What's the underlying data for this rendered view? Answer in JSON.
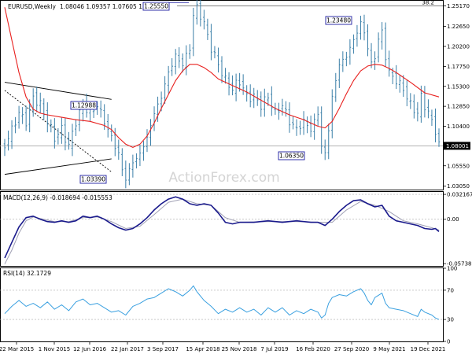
{
  "header": {
    "symbol": "EURUSD,Weekly",
    "ohlc": "1.08046 1.09357 1.07605 1.08001"
  },
  "watermark": "ActionForex.com",
  "colors": {
    "candle": "#3a7fa8",
    "moving_average": "#e8201e",
    "macd_line": "#1a1a8c",
    "macd_signal": "#a0a0b4",
    "rsi_line": "#3aa0e0",
    "trendline": "#000000",
    "box_border": "#1a1aa0",
    "price_box_bg": "#000000"
  },
  "chart_data": [
    {
      "type": "candlestick",
      "panel": "price",
      "series_names": [],
      "ylim": [
        1.0263,
        1.258
      ],
      "y_ticks": [
        "1.25170",
        "1.22650",
        "1.20200",
        "1.17750",
        "1.15300",
        "1.12850",
        "1.10400",
        "1.07950",
        "1.05550",
        "1.03050"
      ],
      "level_line": {
        "label": "38.2",
        "value": 1.2517
      },
      "current_price": {
        "label": "1.08001",
        "value": 1.08001
      },
      "annotations": [
        {
          "label": "1.25550",
          "value": 1.2555
        },
        {
          "label": "1.23480",
          "value": 1.2348
        },
        {
          "label": "1.12988",
          "value": 1.1299
        },
        {
          "label": "1.06350",
          "value": 1.0635
        },
        {
          "label": "1.03390",
          "value": 1.0339
        }
      ],
      "trend_channel": {
        "upper": {
          "from": 1.158,
          "to": 1.137
        },
        "lower": {
          "from": 1.045,
          "to": 1.064
        }
      },
      "x_ticks": [
        "22 Mar 2015",
        "1 Nov 2015",
        "12 Jun 2016",
        "22 Jan 2017",
        "3 Sep 2017",
        "15 Apr 2018",
        "25 Nov 2018",
        "7 Jul 2019",
        "16 Feb 2020",
        "27 Sep 2020",
        "9 May 2021",
        "19 Dec 2021"
      ],
      "close_path": [
        [
          0,
          1.08
        ],
        [
          2,
          1.1
        ],
        [
          4,
          1.12
        ],
        [
          6,
          1.11
        ],
        [
          8,
          1.14
        ],
        [
          10,
          1.13
        ],
        [
          12,
          1.11
        ],
        [
          14,
          1.09
        ],
        [
          16,
          1.1
        ],
        [
          18,
          1.08
        ],
        [
          20,
          1.11
        ],
        [
          22,
          1.13
        ],
        [
          24,
          1.12
        ],
        [
          26,
          1.13
        ],
        [
          28,
          1.11
        ],
        [
          30,
          1.09
        ],
        [
          32,
          1.07
        ],
        [
          33,
          1.05
        ],
        [
          34,
          1.04
        ],
        [
          36,
          1.06
        ],
        [
          38,
          1.07
        ],
        [
          40,
          1.09
        ],
        [
          42,
          1.12
        ],
        [
          44,
          1.14
        ],
        [
          46,
          1.17
        ],
        [
          48,
          1.19
        ],
        [
          50,
          1.18
        ],
        [
          52,
          1.2
        ],
        [
          53,
          1.24
        ],
        [
          54,
          1.25
        ],
        [
          56,
          1.23
        ],
        [
          58,
          1.2
        ],
        [
          60,
          1.18
        ],
        [
          62,
          1.16
        ],
        [
          64,
          1.15
        ],
        [
          66,
          1.16
        ],
        [
          68,
          1.14
        ],
        [
          70,
          1.14
        ],
        [
          72,
          1.13
        ],
        [
          74,
          1.14
        ],
        [
          76,
          1.12
        ],
        [
          78,
          1.13
        ],
        [
          80,
          1.11
        ],
        [
          82,
          1.1
        ],
        [
          84,
          1.11
        ],
        [
          86,
          1.1
        ],
        [
          88,
          1.12
        ],
        [
          89,
          1.08
        ],
        [
          90,
          1.07
        ],
        [
          91,
          1.1
        ],
        [
          92,
          1.14
        ],
        [
          94,
          1.18
        ],
        [
          96,
          1.19
        ],
        [
          98,
          1.21
        ],
        [
          100,
          1.23
        ],
        [
          101,
          1.22
        ],
        [
          102,
          1.2
        ],
        [
          103,
          1.18
        ],
        [
          104,
          1.19
        ],
        [
          105,
          1.21
        ],
        [
          106,
          1.22
        ],
        [
          107,
          1.19
        ],
        [
          108,
          1.17
        ],
        [
          110,
          1.16
        ],
        [
          112,
          1.15
        ],
        [
          114,
          1.13
        ],
        [
          116,
          1.12
        ],
        [
          117,
          1.14
        ],
        [
          118,
          1.13
        ],
        [
          120,
          1.11
        ],
        [
          121,
          1.1
        ],
        [
          122,
          1.08
        ]
      ],
      "moving_average_path": [
        [
          0,
          1.25
        ],
        [
          2,
          1.21
        ],
        [
          4,
          1.17
        ],
        [
          6,
          1.14
        ],
        [
          8,
          1.125
        ],
        [
          10,
          1.12
        ],
        [
          12,
          1.118
        ],
        [
          16,
          1.115
        ],
        [
          20,
          1.112
        ],
        [
          24,
          1.11
        ],
        [
          28,
          1.105
        ],
        [
          30,
          1.1
        ],
        [
          32,
          1.09
        ],
        [
          34,
          1.082
        ],
        [
          36,
          1.078
        ],
        [
          38,
          1.082
        ],
        [
          40,
          1.092
        ],
        [
          42,
          1.108
        ],
        [
          44,
          1.126
        ],
        [
          46,
          1.143
        ],
        [
          48,
          1.16
        ],
        [
          50,
          1.172
        ],
        [
          52,
          1.18
        ],
        [
          54,
          1.18
        ],
        [
          56,
          1.176
        ],
        [
          58,
          1.17
        ],
        [
          60,
          1.162
        ],
        [
          64,
          1.154
        ],
        [
          68,
          1.146
        ],
        [
          72,
          1.136
        ],
        [
          76,
          1.126
        ],
        [
          80,
          1.118
        ],
        [
          84,
          1.112
        ],
        [
          88,
          1.104
        ],
        [
          90,
          1.102
        ],
        [
          92,
          1.11
        ],
        [
          94,
          1.126
        ],
        [
          96,
          1.144
        ],
        [
          98,
          1.16
        ],
        [
          100,
          1.172
        ],
        [
          102,
          1.178
        ],
        [
          104,
          1.18
        ],
        [
          106,
          1.179
        ],
        [
          108,
          1.175
        ],
        [
          110,
          1.17
        ],
        [
          114,
          1.158
        ],
        [
          118,
          1.145
        ],
        [
          122,
          1.14
        ]
      ]
    },
    {
      "type": "line",
      "panel": "macd",
      "label": "MACD(12,26,9) -0.018694 -0.015553",
      "ylim": [
        -0.0603,
        0.0353
      ],
      "y_ticks": [
        "0.032167",
        "0.00",
        "-0.057389"
      ],
      "macd_path": [
        [
          0,
          -0.05
        ],
        [
          2,
          -0.03
        ],
        [
          4,
          -0.01
        ],
        [
          6,
          0.002
        ],
        [
          8,
          0.004
        ],
        [
          10,
          0.0
        ],
        [
          12,
          -0.003
        ],
        [
          14,
          -0.004
        ],
        [
          16,
          -0.002
        ],
        [
          18,
          -0.004
        ],
        [
          20,
          -0.002
        ],
        [
          22,
          0.004
        ],
        [
          24,
          0.002
        ],
        [
          26,
          0.004
        ],
        [
          28,
          0.0
        ],
        [
          30,
          -0.006
        ],
        [
          32,
          -0.011
        ],
        [
          34,
          -0.014
        ],
        [
          36,
          -0.012
        ],
        [
          38,
          -0.006
        ],
        [
          40,
          0.002
        ],
        [
          42,
          0.012
        ],
        [
          44,
          0.02
        ],
        [
          46,
          0.026
        ],
        [
          48,
          0.029
        ],
        [
          50,
          0.026
        ],
        [
          52,
          0.02
        ],
        [
          54,
          0.018
        ],
        [
          56,
          0.02
        ],
        [
          58,
          0.018
        ],
        [
          60,
          0.008
        ],
        [
          62,
          -0.004
        ],
        [
          64,
          -0.006
        ],
        [
          66,
          -0.004
        ],
        [
          70,
          -0.004
        ],
        [
          74,
          -0.002
        ],
        [
          78,
          -0.004
        ],
        [
          82,
          -0.002
        ],
        [
          86,
          -0.004
        ],
        [
          88,
          -0.004
        ],
        [
          90,
          -0.008
        ],
        [
          92,
          0.0
        ],
        [
          94,
          0.01
        ],
        [
          96,
          0.018
        ],
        [
          98,
          0.024
        ],
        [
          100,
          0.025
        ],
        [
          102,
          0.02
        ],
        [
          104,
          0.016
        ],
        [
          106,
          0.018
        ],
        [
          108,
          0.004
        ],
        [
          110,
          -0.002
        ],
        [
          112,
          -0.004
        ],
        [
          114,
          -0.006
        ],
        [
          116,
          -0.008
        ],
        [
          118,
          -0.012
        ],
        [
          120,
          -0.013
        ],
        [
          121,
          -0.012
        ],
        [
          122,
          -0.016
        ]
      ],
      "signal_path": [
        [
          0,
          -0.058
        ],
        [
          2,
          -0.04
        ],
        [
          4,
          -0.018
        ],
        [
          6,
          -0.002
        ],
        [
          8,
          0.003
        ],
        [
          10,
          0.001
        ],
        [
          14,
          -0.003
        ],
        [
          18,
          -0.003
        ],
        [
          22,
          0.002
        ],
        [
          26,
          0.003
        ],
        [
          30,
          -0.003
        ],
        [
          34,
          -0.012
        ],
        [
          38,
          -0.009
        ],
        [
          42,
          0.006
        ],
        [
          46,
          0.022
        ],
        [
          50,
          0.026
        ],
        [
          54,
          0.02
        ],
        [
          58,
          0.018
        ],
        [
          62,
          0.002
        ],
        [
          66,
          -0.004
        ],
        [
          74,
          -0.003
        ],
        [
          82,
          -0.003
        ],
        [
          88,
          -0.004
        ],
        [
          92,
          -0.004
        ],
        [
          96,
          0.012
        ],
        [
          100,
          0.023
        ],
        [
          104,
          0.018
        ],
        [
          108,
          0.01
        ],
        [
          112,
          -0.002
        ],
        [
          116,
          -0.006
        ],
        [
          120,
          -0.011
        ],
        [
          122,
          -0.014
        ]
      ]
    },
    {
      "type": "line",
      "panel": "rsi",
      "label": "RSI(14) 32.1729",
      "ylim": [
        0,
        100
      ],
      "y_ticks": [
        "100",
        "70",
        "30",
        "0"
      ],
      "rsi_path": [
        [
          0,
          38
        ],
        [
          2,
          48
        ],
        [
          4,
          56
        ],
        [
          6,
          48
        ],
        [
          8,
          52
        ],
        [
          10,
          46
        ],
        [
          12,
          54
        ],
        [
          14,
          44
        ],
        [
          16,
          50
        ],
        [
          18,
          42
        ],
        [
          20,
          54
        ],
        [
          22,
          58
        ],
        [
          24,
          50
        ],
        [
          26,
          52
        ],
        [
          28,
          46
        ],
        [
          30,
          40
        ],
        [
          32,
          42
        ],
        [
          34,
          36
        ],
        [
          36,
          48
        ],
        [
          38,
          52
        ],
        [
          40,
          58
        ],
        [
          42,
          60
        ],
        [
          44,
          66
        ],
        [
          46,
          72
        ],
        [
          48,
          68
        ],
        [
          50,
          62
        ],
        [
          52,
          70
        ],
        [
          53,
          76
        ],
        [
          54,
          68
        ],
        [
          56,
          56
        ],
        [
          58,
          48
        ],
        [
          60,
          38
        ],
        [
          62,
          44
        ],
        [
          64,
          40
        ],
        [
          66,
          46
        ],
        [
          68,
          40
        ],
        [
          70,
          44
        ],
        [
          72,
          36
        ],
        [
          74,
          46
        ],
        [
          76,
          40
        ],
        [
          78,
          46
        ],
        [
          80,
          36
        ],
        [
          82,
          42
        ],
        [
          84,
          38
        ],
        [
          86,
          44
        ],
        [
          88,
          40
        ],
        [
          89,
          32
        ],
        [
          90,
          36
        ],
        [
          91,
          52
        ],
        [
          92,
          60
        ],
        [
          94,
          64
        ],
        [
          96,
          62
        ],
        [
          98,
          68
        ],
        [
          100,
          72
        ],
        [
          101,
          66
        ],
        [
          102,
          56
        ],
        [
          103,
          50
        ],
        [
          104,
          60
        ],
        [
          106,
          66
        ],
        [
          107,
          52
        ],
        [
          108,
          46
        ],
        [
          110,
          44
        ],
        [
          112,
          42
        ],
        [
          114,
          38
        ],
        [
          116,
          34
        ],
        [
          117,
          44
        ],
        [
          118,
          40
        ],
        [
          120,
          36
        ],
        [
          121,
          32
        ],
        [
          122,
          30
        ]
      ]
    }
  ]
}
